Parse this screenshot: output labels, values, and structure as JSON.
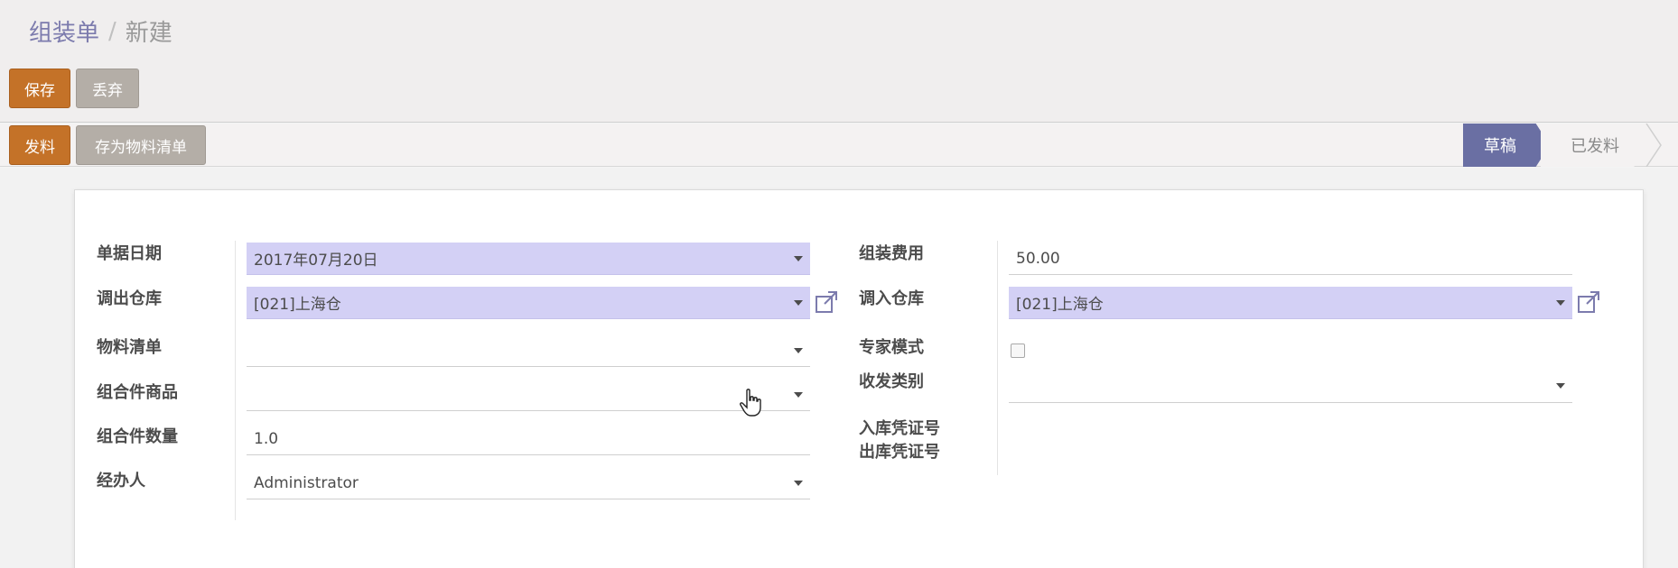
{
  "breadcrumb": {
    "parent": "组装单",
    "separator": "/",
    "current": "新建"
  },
  "toolbar": {
    "save_label": "保存",
    "discard_label": "丢弃"
  },
  "statusbar": {
    "issue_label": "发料",
    "save_bom_label": "存为物料清单",
    "stages": [
      "草稿",
      "已发料"
    ],
    "active_stage": "草稿"
  },
  "form": {
    "left": {
      "date_label": "单据日期",
      "date_value": "2017年07月20日",
      "out_warehouse_label": "调出仓库",
      "out_warehouse_value": "[021]上海仓",
      "bom_label": "物料清单",
      "bom_value": "",
      "product_label": "组合件商品",
      "product_value": "",
      "qty_label": "组合件数量",
      "qty_value": "1.0",
      "handler_label": "经办人",
      "handler_value": "Administrator"
    },
    "right": {
      "fee_label": "组装费用",
      "fee_value": "50.00",
      "in_warehouse_label": "调入仓库",
      "in_warehouse_value": "[021]上海仓",
      "expert_mode_label": "专家模式",
      "category_label": "收发类别",
      "category_value": "",
      "in_voucher_label": "入库凭证号",
      "out_voucher_label": "出库凭证号"
    }
  },
  "colors": {
    "primary_button": "#c47228",
    "secondary_button": "#b4aea7",
    "required_field": "#d3d0f5",
    "active_stage": "#6a6fa3"
  }
}
